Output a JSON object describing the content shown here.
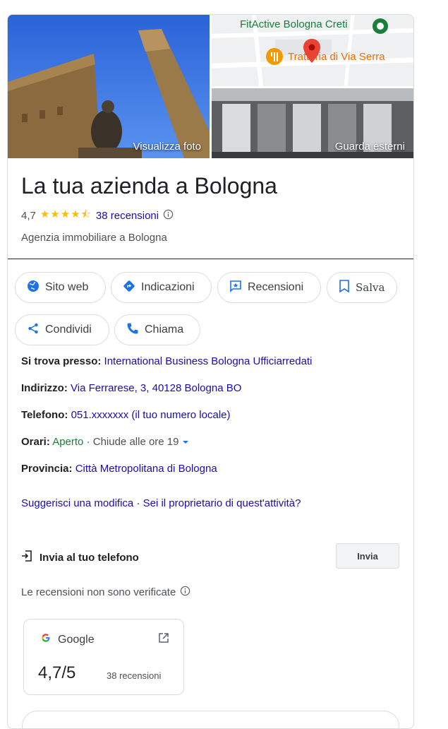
{
  "photos": {
    "left_caption": "Visualizza foto",
    "map_place_1": "FitActive Bologna Creti",
    "map_place_2": "Trattoria di Via Serra",
    "right_caption": "Guarda esterni"
  },
  "business": {
    "name": "La tua azienda a Bologna",
    "rating": "4,7",
    "stars_value": 4.7,
    "reviews_link": "38 recensioni",
    "category": "Agenzia immobiliare a Bologna"
  },
  "actions": {
    "website": "Sito web",
    "directions": "Indicazioni",
    "reviews": "Recensioni",
    "save": "Salva",
    "share": "Condividi",
    "call": "Chiama"
  },
  "info": {
    "located_label": "Si trova presso:",
    "located_value": "International Business Bologna Ufficiarredati",
    "address_label": "Indirizzo:",
    "address_value": "Via Ferrarese, 3, 40128 Bologna BO",
    "phone_label": "Telefono:",
    "phone_value": "051.xxxxxxx (il tuo numero locale)",
    "hours_label": "Orari:",
    "hours_open": "Aperto",
    "hours_detail": "· Chiude alle ore 19",
    "province_label": "Provincia:",
    "province_value": "Città Metropolitana di Bologna"
  },
  "links": {
    "suggest": "Suggerisci una modifica",
    "separator": "·",
    "owner": "Sei il proprietario di quest'attività?"
  },
  "send": {
    "label": "Invia al tuo telefono",
    "button": "Invia"
  },
  "reviews_note": "Le recensioni non sono verificate",
  "google_card": {
    "source": "Google",
    "score": "4,7/5",
    "count": "38 recensioni"
  },
  "colors": {
    "link": "#1a0dab",
    "action_blue": "#1a73e8",
    "star": "#fbbc04",
    "open_green": "#188038"
  }
}
